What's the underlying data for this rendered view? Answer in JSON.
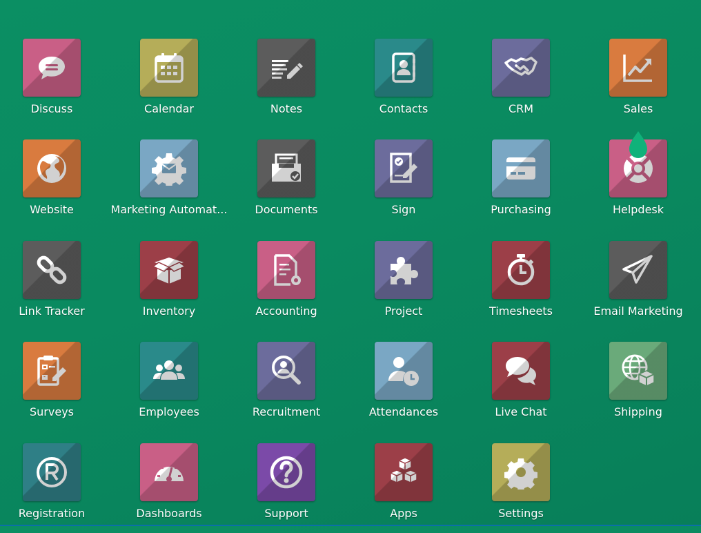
{
  "apps": [
    {
      "label": "Discuss",
      "icon": "discuss-icon",
      "color": "#c95f86"
    },
    {
      "label": "Calendar",
      "icon": "calendar-icon",
      "color": "#b5ad59"
    },
    {
      "label": "Notes",
      "icon": "notes-icon",
      "color": "#5c5c5c"
    },
    {
      "label": "Contacts",
      "icon": "contacts-icon",
      "color": "#2a8a8a"
    },
    {
      "label": "CRM",
      "icon": "handshake-icon",
      "color": "#6c6c9c"
    },
    {
      "label": "Sales",
      "icon": "sales-chart-icon",
      "color": "#d97b3f"
    },
    {
      "label": "Website",
      "icon": "globe-icon",
      "color": "#d97b3f"
    },
    {
      "label": "Marketing Automat...",
      "icon": "marketing-gear-icon",
      "color": "#7aa7c4"
    },
    {
      "label": "Documents",
      "icon": "documents-tray-icon",
      "color": "#5c5c5c"
    },
    {
      "label": "Sign",
      "icon": "sign-document-icon",
      "color": "#6c6c9c"
    },
    {
      "label": "Purchasing",
      "icon": "credit-card-icon",
      "color": "#7aa7c4"
    },
    {
      "label": "Helpdesk",
      "icon": "lifebuoy-icon",
      "color": "#c95f86"
    },
    {
      "label": "Link Tracker",
      "icon": "link-icon",
      "color": "#5c5c5c"
    },
    {
      "label": "Inventory",
      "icon": "box-icon",
      "color": "#9c3f48"
    },
    {
      "label": "Accounting",
      "icon": "accounting-doc-icon",
      "color": "#c95f86"
    },
    {
      "label": "Project",
      "icon": "puzzle-icon",
      "color": "#6c6c9c"
    },
    {
      "label": "Timesheets",
      "icon": "stopwatch-icon",
      "color": "#9c3f48"
    },
    {
      "label": "Email Marketing",
      "icon": "paper-plane-icon",
      "color": "#5c5c5c"
    },
    {
      "label": "Surveys",
      "icon": "survey-clipboard-icon",
      "color": "#d97b3f"
    },
    {
      "label": "Employees",
      "icon": "people-icon",
      "color": "#2a8a8a"
    },
    {
      "label": "Recruitment",
      "icon": "magnifier-user-icon",
      "color": "#6c6c9c"
    },
    {
      "label": "Attendances",
      "icon": "user-clock-icon",
      "color": "#7aa7c4"
    },
    {
      "label": "Live Chat",
      "icon": "chat-bubbles-icon",
      "color": "#9c3f48"
    },
    {
      "label": "Shipping",
      "icon": "globe-box-icon",
      "color": "#6aaa7a"
    },
    {
      "label": "Registration",
      "icon": "registered-icon",
      "color": "#2f7f86"
    },
    {
      "label": "Dashboards",
      "icon": "gauge-icon",
      "color": "#c95f86"
    },
    {
      "label": "Support",
      "icon": "question-icon",
      "color": "#7b4aa8"
    },
    {
      "label": "Apps",
      "icon": "cubes-icon",
      "color": "#9c3f48"
    },
    {
      "label": "Settings",
      "icon": "settings-gear-icon",
      "color": "#b5ad59"
    }
  ],
  "colors": {
    "background": "#0b8f63",
    "drop": "#10b27a"
  }
}
